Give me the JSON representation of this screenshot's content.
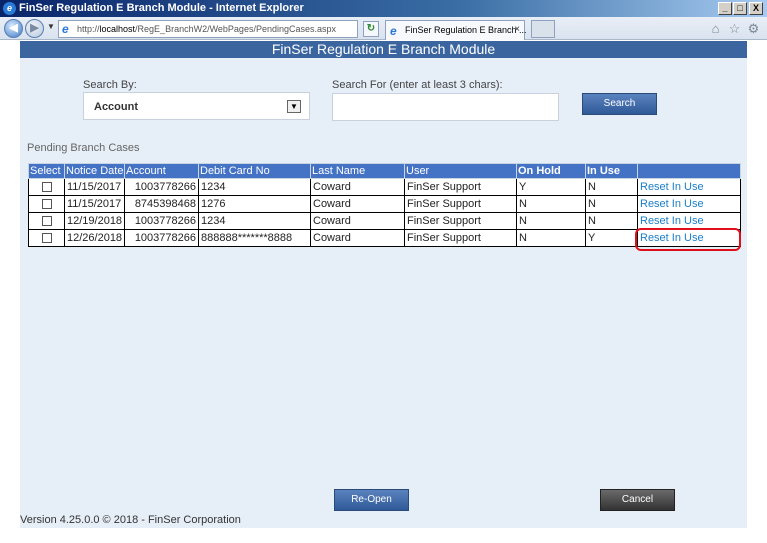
{
  "window": {
    "title": "FinSer Regulation E Branch Module - Internet Explorer",
    "min_label": "_",
    "max_label": "□",
    "close_label": "X"
  },
  "browser": {
    "back_glyph": "◀",
    "forward_glyph": "▶",
    "dropdown_glyph": "▼",
    "url_prefix": "http://",
    "url_host": "localhost",
    "url_path": "/RegE_BranchW2/WebPages/PendingCases.aspx",
    "search_glyph": "⚲",
    "refresh_glyph": "↻",
    "tab_title": "FinSer Regulation E Branch ...",
    "tab_close": "×",
    "ie_glyph": "e",
    "home_glyph": "⌂",
    "favorites_glyph": "☆",
    "tools_glyph": "⚙"
  },
  "header": {
    "title": "FinSer Regulation E Branch Module"
  },
  "search": {
    "by_label": "Search By:",
    "by_value": "Account",
    "for_label": "Search For (enter at least 3 chars):",
    "for_value": "",
    "button_label": "Search"
  },
  "pending": {
    "section_title": "Pending Branch Cases",
    "columns": [
      "Select",
      "Notice Date",
      "Account",
      "Debit Card No",
      "Last Name",
      "User",
      "On Hold",
      "In Use",
      ""
    ],
    "rows": [
      {
        "notice_date": "11/15/2017",
        "account": "1003778266",
        "debit_card": "1234",
        "last_name": "Coward",
        "user": "FinSer Support",
        "on_hold": "Y",
        "in_use": "N",
        "action": "Reset In Use"
      },
      {
        "notice_date": "11/15/2017",
        "account": "8745398468",
        "debit_card": "1276",
        "last_name": "Coward",
        "user": "FinSer Support",
        "on_hold": "N",
        "in_use": "N",
        "action": "Reset In Use"
      },
      {
        "notice_date": "12/19/2018",
        "account": "1003778266",
        "debit_card": "1234",
        "last_name": "Coward",
        "user": "FinSer Support",
        "on_hold": "N",
        "in_use": "N",
        "action": "Reset In Use"
      },
      {
        "notice_date": "12/26/2018",
        "account": "1003778266",
        "debit_card": "888888*******8888",
        "last_name": "Coward",
        "user": "FinSer Support",
        "on_hold": "N",
        "in_use": "Y",
        "action": "Reset In Use"
      }
    ]
  },
  "actions": {
    "reopen_label": "Re-Open",
    "cancel_label": "Cancel"
  },
  "footer": {
    "version": "Version 4.25.0.0 © 2018 - FinSer Corporation"
  },
  "colors": {
    "header_bg": "#3a659e",
    "content_bg": "#e6eef7",
    "table_header_bg": "#4472c4",
    "link": "#1a7ec8",
    "highlight": "#e0101a"
  }
}
